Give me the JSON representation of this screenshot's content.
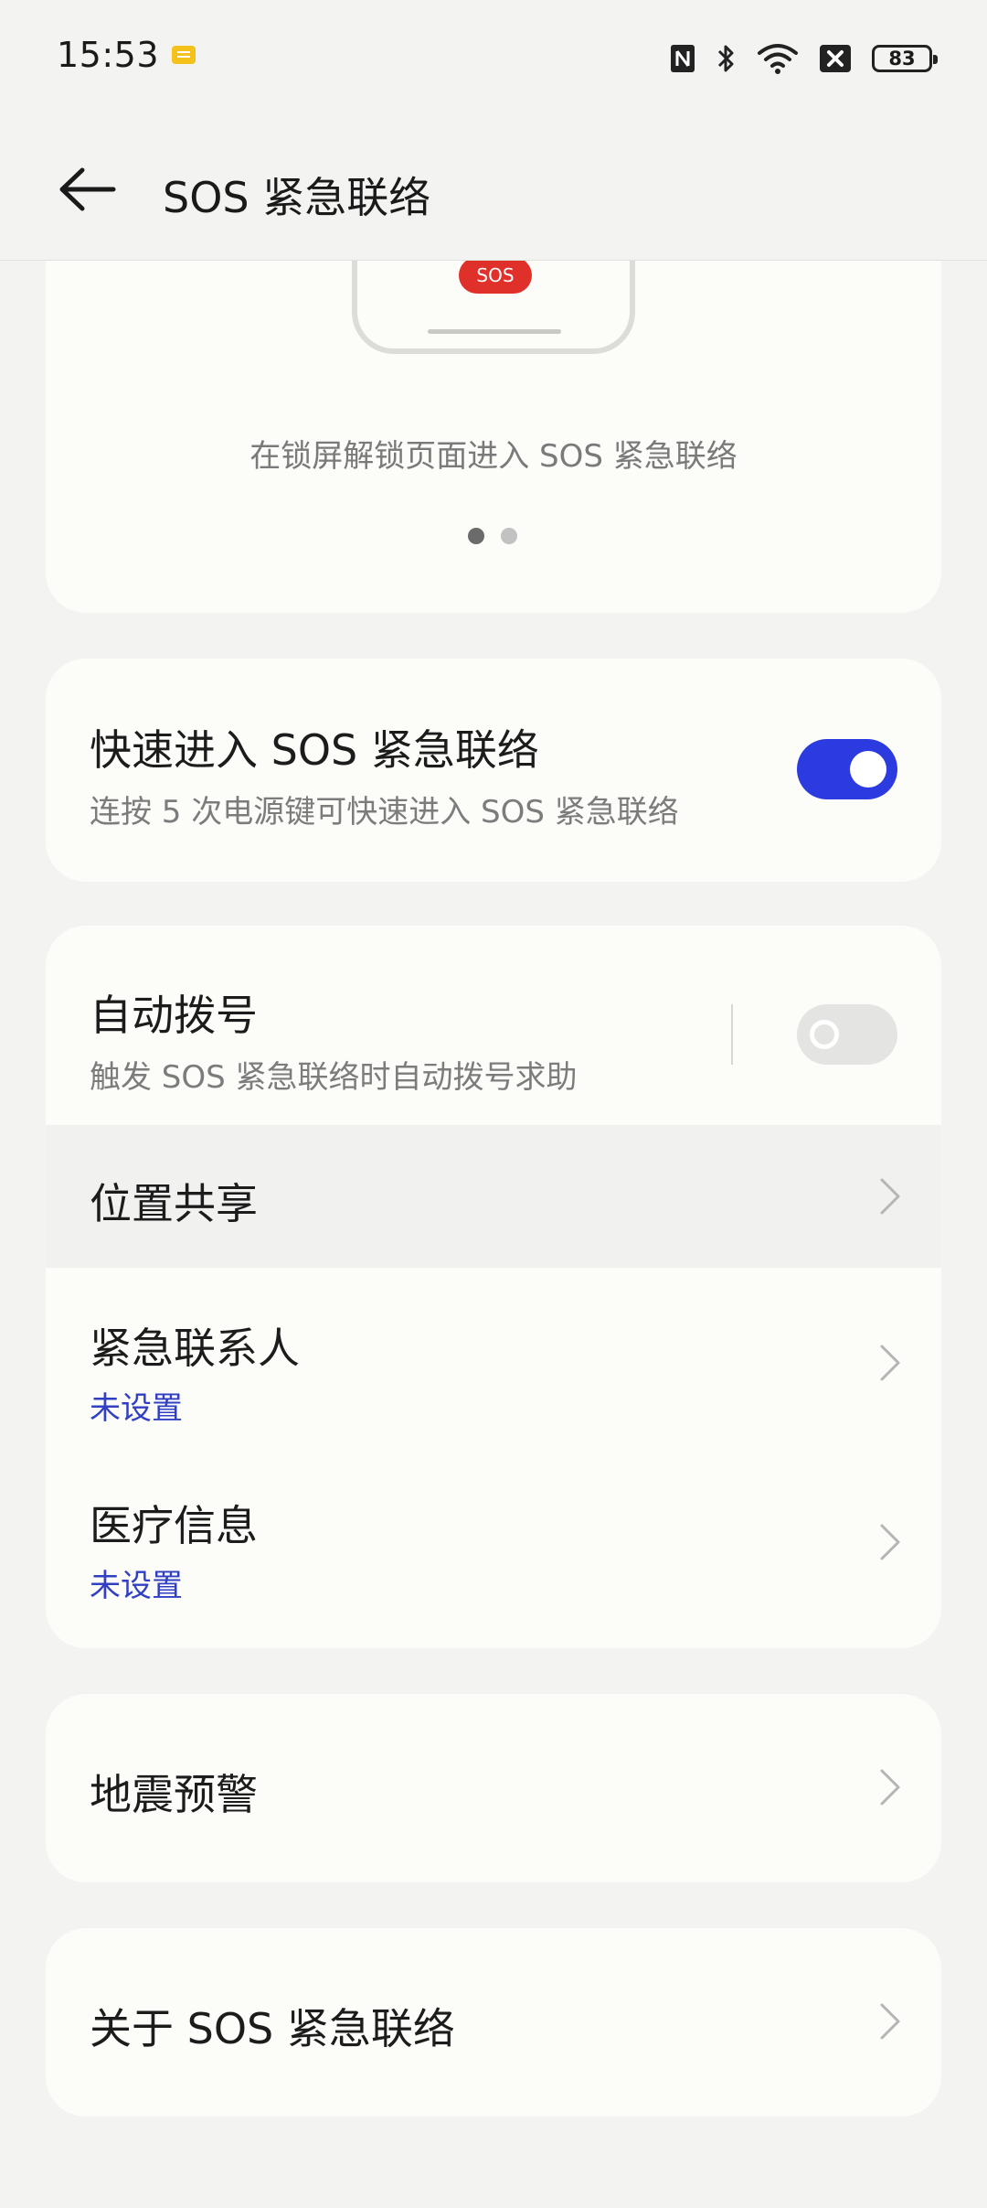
{
  "status_bar": {
    "time": "15:53",
    "battery": "83"
  },
  "header": {
    "title": "SOS 紧急联络"
  },
  "carousel": {
    "badge": "SOS",
    "caption": "在锁屏解锁页面进入 SOS 紧急联络",
    "page_count": 2,
    "active_page": 1
  },
  "quick_access": {
    "title": "快速进入 SOS 紧急联络",
    "subtitle": "连按 5 次电源键可快速进入 SOS 紧急联络",
    "enabled": true
  },
  "settings": {
    "auto_dial": {
      "title": "自动拨号",
      "subtitle": "触发 SOS 紧急联络时自动拨号求助",
      "enabled": false
    },
    "location_sharing": {
      "title": "位置共享"
    },
    "emergency_contacts": {
      "title": "紧急联系人",
      "status": "未设置"
    },
    "medical_info": {
      "title": "医疗信息",
      "status": "未设置"
    }
  },
  "earthquake": {
    "title": "地震预警"
  },
  "about": {
    "title": "关于 SOS 紧急联络"
  },
  "colors": {
    "accent": "#2c3be0",
    "link": "#3140c3",
    "sos_red": "#e0302a",
    "background": "#f3f3f1"
  }
}
